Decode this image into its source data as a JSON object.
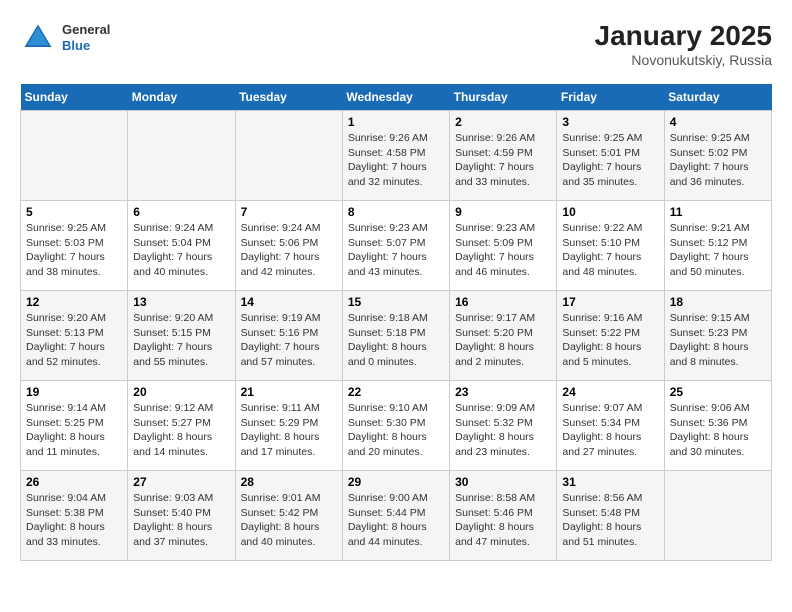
{
  "header": {
    "logo": {
      "general": "General",
      "blue": "Blue"
    },
    "title": "January 2025",
    "location": "Novonukutskiy, Russia"
  },
  "weekdays": [
    "Sunday",
    "Monday",
    "Tuesday",
    "Wednesday",
    "Thursday",
    "Friday",
    "Saturday"
  ],
  "weeks": [
    [
      {
        "day": "",
        "sunrise": "",
        "sunset": "",
        "daylight": ""
      },
      {
        "day": "",
        "sunrise": "",
        "sunset": "",
        "daylight": ""
      },
      {
        "day": "",
        "sunrise": "",
        "sunset": "",
        "daylight": ""
      },
      {
        "day": "1",
        "sunrise": "Sunrise: 9:26 AM",
        "sunset": "Sunset: 4:58 PM",
        "daylight": "Daylight: 7 hours and 32 minutes."
      },
      {
        "day": "2",
        "sunrise": "Sunrise: 9:26 AM",
        "sunset": "Sunset: 4:59 PM",
        "daylight": "Daylight: 7 hours and 33 minutes."
      },
      {
        "day": "3",
        "sunrise": "Sunrise: 9:25 AM",
        "sunset": "Sunset: 5:01 PM",
        "daylight": "Daylight: 7 hours and 35 minutes."
      },
      {
        "day": "4",
        "sunrise": "Sunrise: 9:25 AM",
        "sunset": "Sunset: 5:02 PM",
        "daylight": "Daylight: 7 hours and 36 minutes."
      }
    ],
    [
      {
        "day": "5",
        "sunrise": "Sunrise: 9:25 AM",
        "sunset": "Sunset: 5:03 PM",
        "daylight": "Daylight: 7 hours and 38 minutes."
      },
      {
        "day": "6",
        "sunrise": "Sunrise: 9:24 AM",
        "sunset": "Sunset: 5:04 PM",
        "daylight": "Daylight: 7 hours and 40 minutes."
      },
      {
        "day": "7",
        "sunrise": "Sunrise: 9:24 AM",
        "sunset": "Sunset: 5:06 PM",
        "daylight": "Daylight: 7 hours and 42 minutes."
      },
      {
        "day": "8",
        "sunrise": "Sunrise: 9:23 AM",
        "sunset": "Sunset: 5:07 PM",
        "daylight": "Daylight: 7 hours and 43 minutes."
      },
      {
        "day": "9",
        "sunrise": "Sunrise: 9:23 AM",
        "sunset": "Sunset: 5:09 PM",
        "daylight": "Daylight: 7 hours and 46 minutes."
      },
      {
        "day": "10",
        "sunrise": "Sunrise: 9:22 AM",
        "sunset": "Sunset: 5:10 PM",
        "daylight": "Daylight: 7 hours and 48 minutes."
      },
      {
        "day": "11",
        "sunrise": "Sunrise: 9:21 AM",
        "sunset": "Sunset: 5:12 PM",
        "daylight": "Daylight: 7 hours and 50 minutes."
      }
    ],
    [
      {
        "day": "12",
        "sunrise": "Sunrise: 9:20 AM",
        "sunset": "Sunset: 5:13 PM",
        "daylight": "Daylight: 7 hours and 52 minutes."
      },
      {
        "day": "13",
        "sunrise": "Sunrise: 9:20 AM",
        "sunset": "Sunset: 5:15 PM",
        "daylight": "Daylight: 7 hours and 55 minutes."
      },
      {
        "day": "14",
        "sunrise": "Sunrise: 9:19 AM",
        "sunset": "Sunset: 5:16 PM",
        "daylight": "Daylight: 7 hours and 57 minutes."
      },
      {
        "day": "15",
        "sunrise": "Sunrise: 9:18 AM",
        "sunset": "Sunset: 5:18 PM",
        "daylight": "Daylight: 8 hours and 0 minutes."
      },
      {
        "day": "16",
        "sunrise": "Sunrise: 9:17 AM",
        "sunset": "Sunset: 5:20 PM",
        "daylight": "Daylight: 8 hours and 2 minutes."
      },
      {
        "day": "17",
        "sunrise": "Sunrise: 9:16 AM",
        "sunset": "Sunset: 5:22 PM",
        "daylight": "Daylight: 8 hours and 5 minutes."
      },
      {
        "day": "18",
        "sunrise": "Sunrise: 9:15 AM",
        "sunset": "Sunset: 5:23 PM",
        "daylight": "Daylight: 8 hours and 8 minutes."
      }
    ],
    [
      {
        "day": "19",
        "sunrise": "Sunrise: 9:14 AM",
        "sunset": "Sunset: 5:25 PM",
        "daylight": "Daylight: 8 hours and 11 minutes."
      },
      {
        "day": "20",
        "sunrise": "Sunrise: 9:12 AM",
        "sunset": "Sunset: 5:27 PM",
        "daylight": "Daylight: 8 hours and 14 minutes."
      },
      {
        "day": "21",
        "sunrise": "Sunrise: 9:11 AM",
        "sunset": "Sunset: 5:29 PM",
        "daylight": "Daylight: 8 hours and 17 minutes."
      },
      {
        "day": "22",
        "sunrise": "Sunrise: 9:10 AM",
        "sunset": "Sunset: 5:30 PM",
        "daylight": "Daylight: 8 hours and 20 minutes."
      },
      {
        "day": "23",
        "sunrise": "Sunrise: 9:09 AM",
        "sunset": "Sunset: 5:32 PM",
        "daylight": "Daylight: 8 hours and 23 minutes."
      },
      {
        "day": "24",
        "sunrise": "Sunrise: 9:07 AM",
        "sunset": "Sunset: 5:34 PM",
        "daylight": "Daylight: 8 hours and 27 minutes."
      },
      {
        "day": "25",
        "sunrise": "Sunrise: 9:06 AM",
        "sunset": "Sunset: 5:36 PM",
        "daylight": "Daylight: 8 hours and 30 minutes."
      }
    ],
    [
      {
        "day": "26",
        "sunrise": "Sunrise: 9:04 AM",
        "sunset": "Sunset: 5:38 PM",
        "daylight": "Daylight: 8 hours and 33 minutes."
      },
      {
        "day": "27",
        "sunrise": "Sunrise: 9:03 AM",
        "sunset": "Sunset: 5:40 PM",
        "daylight": "Daylight: 8 hours and 37 minutes."
      },
      {
        "day": "28",
        "sunrise": "Sunrise: 9:01 AM",
        "sunset": "Sunset: 5:42 PM",
        "daylight": "Daylight: 8 hours and 40 minutes."
      },
      {
        "day": "29",
        "sunrise": "Sunrise: 9:00 AM",
        "sunset": "Sunset: 5:44 PM",
        "daylight": "Daylight: 8 hours and 44 minutes."
      },
      {
        "day": "30",
        "sunrise": "Sunrise: 8:58 AM",
        "sunset": "Sunset: 5:46 PM",
        "daylight": "Daylight: 8 hours and 47 minutes."
      },
      {
        "day": "31",
        "sunrise": "Sunrise: 8:56 AM",
        "sunset": "Sunset: 5:48 PM",
        "daylight": "Daylight: 8 hours and 51 minutes."
      },
      {
        "day": "",
        "sunrise": "",
        "sunset": "",
        "daylight": ""
      }
    ]
  ]
}
